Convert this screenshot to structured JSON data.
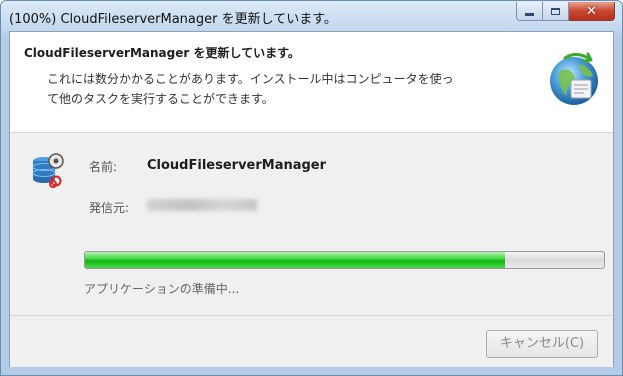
{
  "window": {
    "title": "(100%) CloudFileserverManager を更新しています。"
  },
  "header": {
    "title": "CloudFileserverManager を更新しています。",
    "desc_line1": "これには数分かかることがあります。インストール中はコンピュータを使っ",
    "desc_line2": "て他のタスクを実行することができます。",
    "icon": "globe-install-icon"
  },
  "app": {
    "name_label": "名前:",
    "name_value": "CloudFileserverManager",
    "publisher_label": "発信元:",
    "icon": "app-database-icon"
  },
  "progress": {
    "fraction": 0.81,
    "status": "アプリケーションの準備中..."
  },
  "buttons": {
    "cancel": "キャンセル(C)"
  },
  "colors": {
    "progress_green": "#22c322",
    "titlebar_blue": "#c2d7ee",
    "close_red": "#c7472d"
  }
}
